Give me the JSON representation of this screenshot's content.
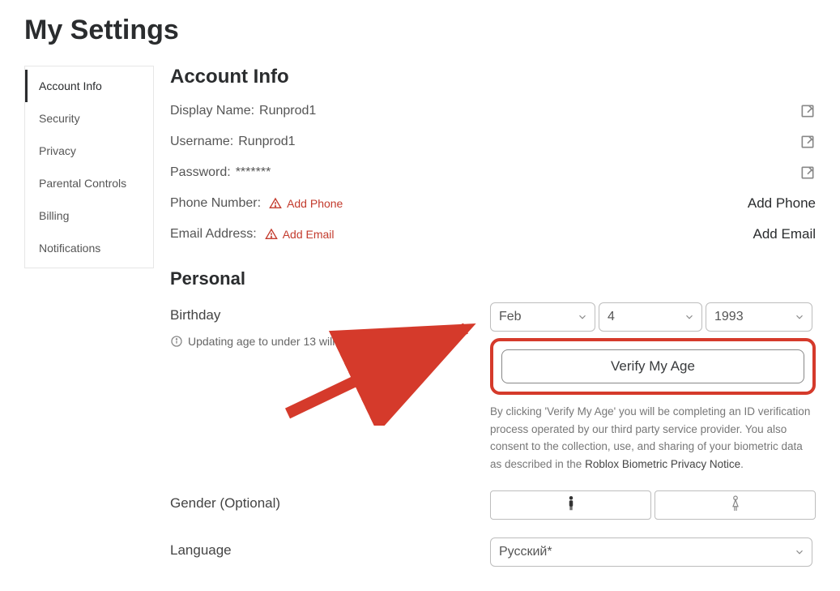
{
  "page": {
    "title": "My Settings"
  },
  "sidebar": {
    "items": [
      {
        "label": "Account Info",
        "active": true
      },
      {
        "label": "Security",
        "active": false
      },
      {
        "label": "Privacy",
        "active": false
      },
      {
        "label": "Parental Controls",
        "active": false
      },
      {
        "label": "Billing",
        "active": false
      },
      {
        "label": "Notifications",
        "active": false
      }
    ]
  },
  "account_info": {
    "heading": "Account Info",
    "display_name_label": "Display Name:",
    "display_name_value": "Runprod1",
    "username_label": "Username:",
    "username_value": "Runprod1",
    "password_label": "Password:",
    "password_value": "*******",
    "phone_label": "Phone Number:",
    "phone_add_link": "Add Phone",
    "phone_action": "Add Phone",
    "email_label": "Email Address:",
    "email_add_link": "Add Email",
    "email_action": "Add Email"
  },
  "personal": {
    "heading": "Personal",
    "birthday_label": "Birthday",
    "birthday_month": "Feb",
    "birthday_day": "4",
    "birthday_year": "1993",
    "under13_hint": "Updating age to under 13 will enable Privacy Mode.",
    "verify_button": "Verify My Age",
    "disclaimer_pre": "By clicking 'Verify My Age' you will be completing an ID verification process operated by our third party service provider. You also consent to the collection, use, and sharing of your biometric data as described in the ",
    "disclaimer_link": "Roblox Biometric Privacy Notice",
    "disclaimer_post": ".",
    "gender_label": "Gender (Optional)",
    "language_label": "Language",
    "language_value": "Русский*"
  },
  "icons": {
    "edit": "edit-icon",
    "warn": "warning-triangle-icon",
    "info": "info-circle-icon",
    "chevron": "chevron-down-icon",
    "male": "male-icon",
    "female": "female-icon"
  },
  "annotation": {
    "arrow_color": "#d53a2b"
  }
}
